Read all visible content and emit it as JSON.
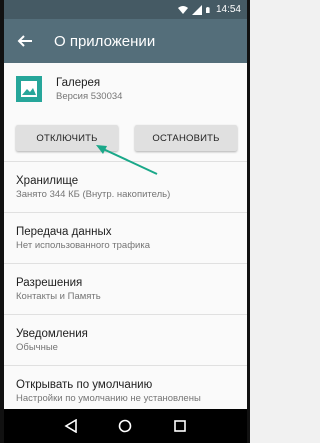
{
  "status": {
    "time": "14:54"
  },
  "appbar": {
    "title": "О приложении"
  },
  "app": {
    "name": "Галерея",
    "version": "Версия 530034"
  },
  "actions": {
    "disable_label": "ОТКЛЮЧИТЬ",
    "stop_label": "ОСТАНОВИТЬ"
  },
  "items": [
    {
      "title": "Хранилище",
      "subtitle": "Занято 344  КБ (Внутр. накопитель)"
    },
    {
      "title": "Передача данных",
      "subtitle": "Нет использованного трафика"
    },
    {
      "title": "Разрешения",
      "subtitle": "Контакты и Память"
    },
    {
      "title": "Уведомления",
      "subtitle": "Обычные"
    },
    {
      "title": "Открывать по умолчанию",
      "subtitle": "Настройки по умолчанию не установлены"
    }
  ],
  "colors": {
    "statusbar": "#455a64",
    "appbar": "#546e7a",
    "app_icon": "#26a69a",
    "annotation_arrow": "#1aa889"
  },
  "icons": [
    "wifi-icon",
    "signal-icon",
    "battery-icon",
    "back-arrow-icon",
    "gallery-app-icon",
    "nav-back-icon",
    "nav-home-icon",
    "nav-recents-icon"
  ]
}
